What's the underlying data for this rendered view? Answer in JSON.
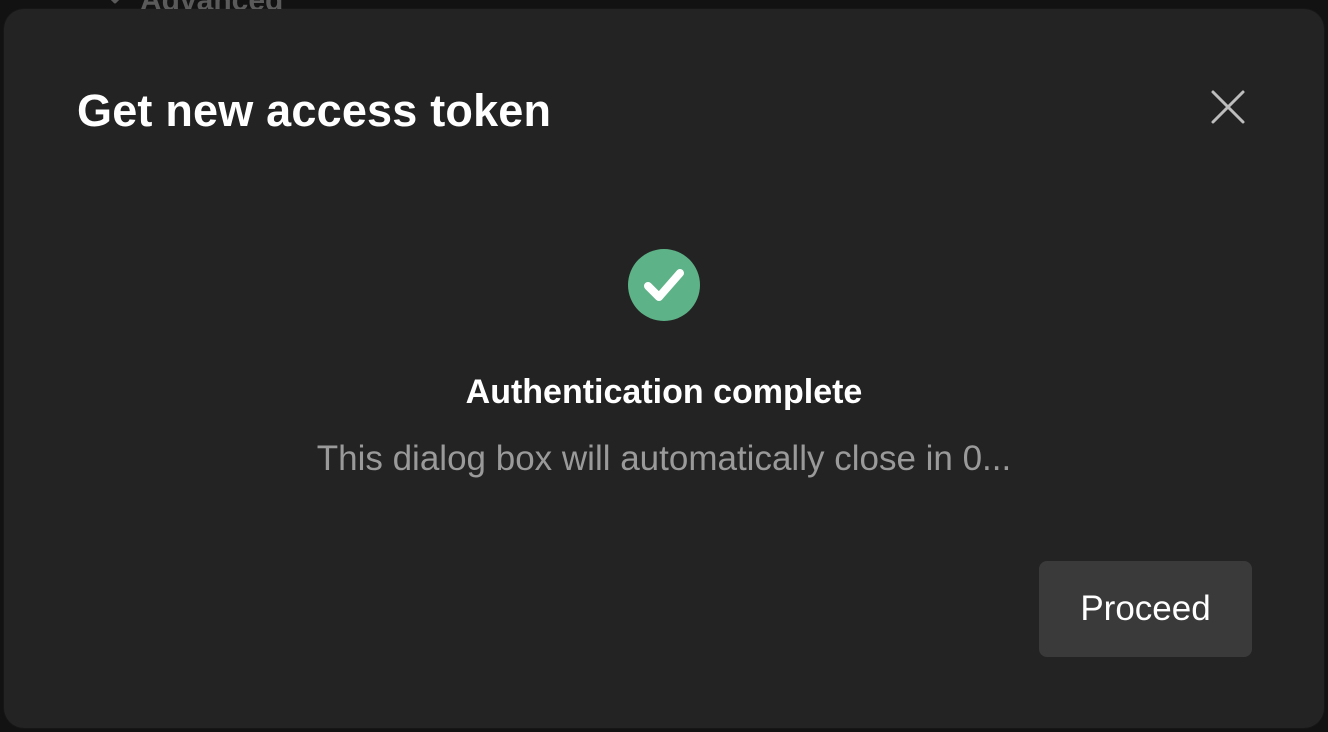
{
  "background": {
    "section_label": "Advanced"
  },
  "dialog": {
    "title": "Get new access token",
    "close_icon": "close-icon",
    "status": {
      "icon": "check-circle-icon",
      "icon_color": "#5db287",
      "heading": "Authentication complete",
      "message": "This dialog box will automatically close in 0..."
    },
    "proceed_label": "Proceed"
  }
}
